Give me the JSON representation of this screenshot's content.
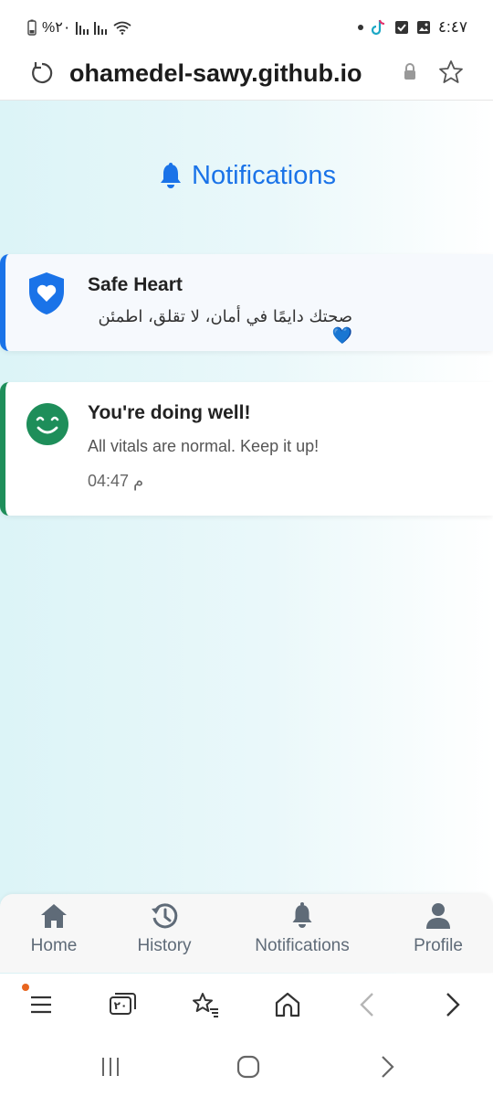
{
  "status_bar": {
    "time": "٤:٤٧",
    "battery": "%٢٠",
    "icons": [
      "battery-icon",
      "signal-icon",
      "signal-icon",
      "wifi-icon",
      "dot-icon",
      "tiktok-icon",
      "checkbox-icon",
      "image-icon"
    ]
  },
  "browser": {
    "url": "ohamedel-sawy.github.io",
    "icons": [
      "reload-icon",
      "lock-icon",
      "star-icon"
    ],
    "tab_count": "٢٠",
    "toolbar_icons": [
      "menu-icon",
      "tabs-icon",
      "bookmarks-icon",
      "home-icon",
      "back-icon",
      "forward-icon"
    ]
  },
  "page": {
    "title": "Notifications",
    "title_icon": "bell-icon",
    "accent_color": "#1a73e8"
  },
  "notifications": [
    {
      "title": "Safe Heart",
      "message": "صحتك دايمًا في أمان، لا تقلق، اطمئن 💙",
      "icon": "shield-heart-icon",
      "color": "#1a73e8"
    },
    {
      "title": "You're doing well!",
      "message": "All vitals are normal. Keep it up!",
      "time": "04:47 م",
      "icon": "smile-icon",
      "color": "#1e8e5a"
    }
  ],
  "bottom_nav": [
    {
      "label": "Home",
      "icon": "home-icon"
    },
    {
      "label": "History",
      "icon": "history-icon"
    },
    {
      "label": "Notifications",
      "icon": "bell-icon"
    },
    {
      "label": "Profile",
      "icon": "user-icon"
    }
  ],
  "system_nav": [
    "recent-apps-icon",
    "home-circle-icon",
    "back-chevron-icon"
  ]
}
